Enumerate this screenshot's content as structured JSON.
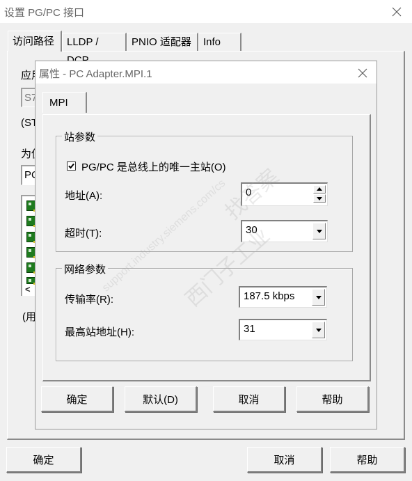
{
  "outer_window": {
    "title": "设置 PG/PC 接口",
    "tabs": [
      {
        "label": "访问路径",
        "active": true
      },
      {
        "label": "LLDP / DCP",
        "active": false
      },
      {
        "label": "PNIO 适配器",
        "active": false
      },
      {
        "label": "Info",
        "active": false
      }
    ],
    "background_labels": {
      "app_access_point_label": "应用",
      "app_access_point_value": "S7",
      "standard_note": "(ST",
      "interface_assign_label": "为使",
      "interface_value": "PC",
      "usage_note": "(用"
    },
    "device_list_count": 6,
    "buttons": {
      "ok": "确定",
      "cancel": "取消",
      "help": "帮助"
    }
  },
  "inner_dialog": {
    "title": "属性 - PC Adapter.MPI.1",
    "tabs": [
      {
        "label": "MPI",
        "active": true
      }
    ],
    "station_params": {
      "legend": "站参数",
      "only_master_checkbox": {
        "label": "PG/PC 是总线上的唯一主站(O)",
        "checked": true
      },
      "address": {
        "label": "地址(A):",
        "value": "0"
      },
      "timeout": {
        "label": "超时(T):",
        "value": "30"
      }
    },
    "network_params": {
      "legend": "网络参数",
      "transmission_rate": {
        "label": "传输率(R):",
        "value": "187.5 kbps"
      },
      "highest_address": {
        "label": "最高站地址(H):",
        "value": "31"
      }
    },
    "buttons": {
      "ok": "确定",
      "default": "默认(D)",
      "cancel": "取消",
      "help": "帮助"
    }
  },
  "watermark": {
    "text_1": "西门子工业",
    "text_2": "找答案",
    "text_3": "support.industry.siemens.com/cs"
  }
}
